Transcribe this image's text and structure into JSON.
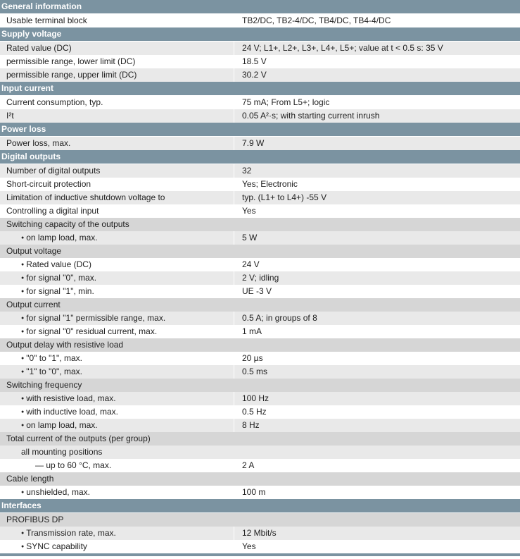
{
  "sections": {
    "general": {
      "title": "General information",
      "rows": [
        [
          "Usable terminal block",
          "TB2/DC, TB2-4/DC, TB4/DC, TB4-4/DC"
        ]
      ]
    },
    "supply": {
      "title": "Supply voltage",
      "rows": [
        [
          "Rated value (DC)",
          "24 V; L1+, L2+, L3+, L4+, L5+; value at t < 0.5 s: 35 V"
        ],
        [
          "permissible range, lower limit (DC)",
          "18.5 V"
        ],
        [
          "permissible range, upper limit (DC)",
          "30.2 V"
        ]
      ]
    },
    "input": {
      "title": "Input current",
      "rows": [
        [
          "Current consumption, typ.",
          "75 mA; From L5+; logic"
        ],
        [
          "I²t",
          "0.05 A²·s; with starting current inrush"
        ]
      ]
    },
    "power": {
      "title": "Power loss",
      "rows": [
        [
          "Power loss, max.",
          "7.9 W"
        ]
      ]
    },
    "digital": {
      "title": "Digital outputs",
      "rows": [
        [
          "Number of digital outputs",
          "32"
        ],
        [
          "Short-circuit protection",
          "Yes; Electronic"
        ],
        [
          "Limitation of inductive shutdown voltage to",
          "typ. (L1+ to L4+) -55 V"
        ],
        [
          "Controlling a digital input",
          "Yes"
        ]
      ],
      "switching_capacity": {
        "title": "Switching capacity of the outputs",
        "rows": [
          [
            "on lamp load, max.",
            "5 W"
          ]
        ]
      },
      "output_voltage": {
        "title": "Output voltage",
        "rows": [
          [
            "Rated value (DC)",
            "24 V"
          ],
          [
            "for signal \"0\", max.",
            "2 V; idling"
          ],
          [
            "for signal \"1\", min.",
            "UE -3 V"
          ]
        ]
      },
      "output_current": {
        "title": "Output current",
        "rows": [
          [
            "for signal \"1\" permissible range, max.",
            "0.5 A; in groups of 8"
          ],
          [
            "for signal \"0\" residual current, max.",
            "1 mA"
          ]
        ]
      },
      "output_delay": {
        "title": "Output delay with resistive load",
        "rows": [
          [
            "\"0\" to \"1\", max.",
            "20 µs"
          ],
          [
            "\"1\" to \"0\", max.",
            "0.5 ms"
          ]
        ]
      },
      "switching_freq": {
        "title": "Switching frequency",
        "rows": [
          [
            "with resistive load, max.",
            "100 Hz"
          ],
          [
            "with inductive load, max.",
            "0.5 Hz"
          ],
          [
            "on lamp load, max.",
            "8 Hz"
          ]
        ]
      },
      "total_current": {
        "title": "Total current of the outputs (per group)",
        "sub": "all mounting positions",
        "rows": [
          [
            "— up to 60 °C, max.",
            "2 A"
          ]
        ]
      },
      "cable": {
        "title": "Cable length",
        "rows": [
          [
            "unshielded, max.",
            "100 m"
          ]
        ]
      }
    },
    "interfaces": {
      "title": "Interfaces",
      "profibus": {
        "title": "PROFIBUS DP",
        "rows": [
          [
            "Transmission rate, max.",
            "12 Mbit/s"
          ],
          [
            "SYNC capability",
            "Yes"
          ]
        ]
      }
    }
  }
}
